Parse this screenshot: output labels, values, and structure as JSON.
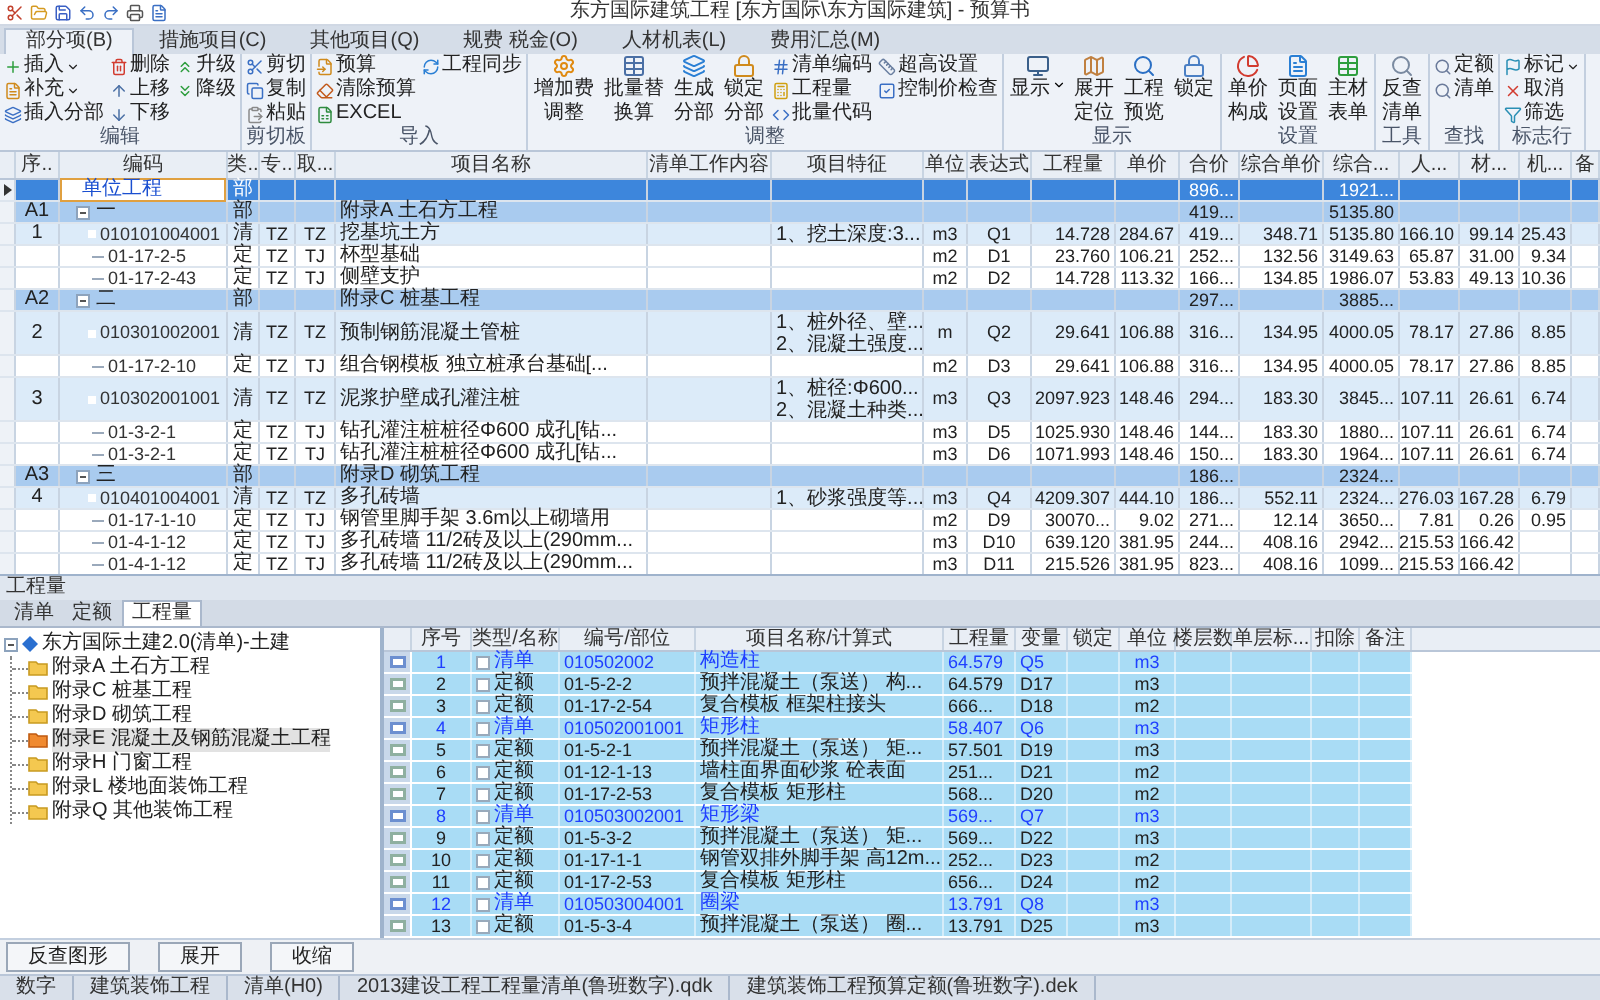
{
  "window": {
    "title": "东方国际建筑工程 [东方国际\\东方国际建筑] - 预算书"
  },
  "ribbon_tabs": [
    {
      "label": "部分项(B)",
      "selected": true
    },
    {
      "label": "措施项目(C)",
      "selected": false
    },
    {
      "label": "其他项目(Q)",
      "selected": false
    },
    {
      "label": "规费 税金(O)",
      "selected": false
    },
    {
      "label": "人材机表(L)",
      "selected": false
    },
    {
      "label": "费用汇总(M)",
      "selected": false
    }
  ],
  "ribbon_groups": [
    {
      "label": "编辑",
      "items": [
        {
          "label": "插入",
          "kind": "small",
          "dropdown": true
        },
        {
          "label": "补充",
          "kind": "small",
          "dropdown": true
        },
        {
          "label": "插入分部",
          "kind": "small"
        },
        {
          "label": "删除",
          "kind": "small"
        },
        {
          "label": "上移",
          "kind": "small"
        },
        {
          "label": "下移",
          "kind": "small"
        },
        {
          "label": "升级",
          "kind": "small"
        },
        {
          "label": "降级",
          "kind": "small"
        }
      ]
    },
    {
      "label": "剪切板",
      "items": [
        {
          "label": "剪切",
          "kind": "small"
        },
        {
          "label": "复制",
          "kind": "small"
        },
        {
          "label": "粘贴",
          "kind": "small"
        }
      ]
    },
    {
      "label": "导入",
      "items": [
        {
          "label": "预算",
          "kind": "small"
        },
        {
          "label": "清除预算",
          "kind": "small"
        },
        {
          "label": "EXCEL",
          "kind": "small"
        },
        {
          "label": "工程同步",
          "kind": "small"
        }
      ]
    },
    {
      "label": "调整",
      "items": [
        {
          "label": "增加费调整",
          "kind": "large"
        },
        {
          "label": "批量替换算",
          "kind": "large"
        },
        {
          "label": "生成分部",
          "kind": "large"
        },
        {
          "label": "锁定分部",
          "kind": "large"
        },
        {
          "label": "清单编码",
          "kind": "small"
        },
        {
          "label": "工程量",
          "kind": "small"
        },
        {
          "label": "批量代码",
          "kind": "small"
        },
        {
          "label": "超高设置",
          "kind": "small"
        },
        {
          "label": "控制价检查",
          "kind": "small"
        }
      ]
    },
    {
      "label": "显示",
      "items": [
        {
          "label": "显示",
          "kind": "large",
          "dropdown": true
        },
        {
          "label": "展开定位",
          "kind": "large"
        },
        {
          "label": "工程预览",
          "kind": "large"
        },
        {
          "label": "锁定",
          "kind": "large"
        }
      ]
    },
    {
      "label": "设置",
      "items": [
        {
          "label": "单价构成",
          "kind": "large"
        },
        {
          "label": "页面设置",
          "kind": "large"
        },
        {
          "label": "主材表单",
          "kind": "large"
        }
      ]
    },
    {
      "label": "工具",
      "items": [
        {
          "label": "反查清单",
          "kind": "large"
        }
      ]
    },
    {
      "label": "查找",
      "items": [
        {
          "label": "定额",
          "kind": "small"
        },
        {
          "label": "清单",
          "kind": "small"
        }
      ]
    },
    {
      "label": "标志行",
      "items": [
        {
          "label": "标记",
          "kind": "small",
          "dropdown": true
        },
        {
          "label": "取消",
          "kind": "small"
        },
        {
          "label": "筛选",
          "kind": "small"
        }
      ]
    }
  ],
  "estimate_table": {
    "columns": [
      "序..",
      "编码",
      "类..",
      "专..",
      "取...",
      "项目名称",
      "清单工作内容",
      "项目特征",
      "单位",
      "表达式",
      "工程量",
      "单价",
      "合价",
      "综合单价",
      "综合...",
      "人...",
      "材...",
      "机...",
      "备"
    ],
    "rows": [
      {
        "kind": "unit",
        "selected": true,
        "code": "单位工程",
        "category": "部",
        "amount": "896...",
        "comp_amount": "1921..."
      },
      {
        "kind": "section",
        "selected": false,
        "no": "A1",
        "code": "一",
        "category": "部",
        "name": "附录A 土石方工程",
        "amount": "419...",
        "comp_amount": "5135.80"
      },
      {
        "kind": "bill",
        "selected": false,
        "no": "1",
        "code": "010101004001",
        "category": "清",
        "specialty": "TZ",
        "fee": "TZ",
        "name": "挖基坑土方",
        "features": [
          "1、挖土深度:3..."
        ],
        "unit": "m3",
        "expr": "Q1",
        "qty": "14.728",
        "price": "284.67",
        "amount": "419...",
        "comp_price": "348.71",
        "comp_amount": "5135.80",
        "labor": "166.10",
        "material": "99.14",
        "machine": "25.43"
      },
      {
        "kind": "quota",
        "selected": false,
        "code": "01-17-2-5",
        "category": "定",
        "specialty": "TZ",
        "fee": "TJ",
        "name": "杯型基础",
        "unit": "m2",
        "expr": "D1",
        "qty": "23.760",
        "price": "106.21",
        "amount": "252...",
        "comp_price": "132.56",
        "comp_amount": "3149.63",
        "labor": "65.87",
        "material": "31.00",
        "machine": "9.34"
      },
      {
        "kind": "quota",
        "selected": false,
        "code": "01-17-2-43",
        "category": "定",
        "specialty": "TZ",
        "fee": "TJ",
        "name": "侧壁支护",
        "unit": "m2",
        "expr": "D2",
        "qty": "14.728",
        "price": "113.32",
        "amount": "166...",
        "comp_price": "134.85",
        "comp_amount": "1986.07",
        "labor": "53.83",
        "material": "49.13",
        "machine": "10.36"
      },
      {
        "kind": "section",
        "selected": false,
        "no": "A2",
        "code": "二",
        "category": "部",
        "name": "附录C 桩基工程",
        "amount": "297...",
        "comp_amount": "3885..."
      },
      {
        "kind": "bill",
        "selected": false,
        "no": "2",
        "code": "010301002001",
        "category": "清",
        "specialty": "TZ",
        "fee": "TZ",
        "name": "预制钢筋混凝土管桩",
        "features": [
          "1、桩外径、壁...",
          "2、混凝土强度..."
        ],
        "unit": "m",
        "expr": "Q2",
        "qty": "29.641",
        "price": "106.88",
        "amount": "316...",
        "comp_price": "134.95",
        "comp_amount": "4000.05",
        "labor": "78.17",
        "material": "27.86",
        "machine": "8.85"
      },
      {
        "kind": "quota",
        "selected": false,
        "code": "01-17-2-10",
        "category": "定",
        "specialty": "TZ",
        "fee": "TJ",
        "name": "组合钢模板 独立桩承台基础[...",
        "unit": "m2",
        "expr": "D3",
        "qty": "29.641",
        "price": "106.88",
        "amount": "316...",
        "comp_price": "134.95",
        "comp_amount": "4000.05",
        "labor": "78.17",
        "material": "27.86",
        "machine": "8.85"
      },
      {
        "kind": "bill",
        "selected": false,
        "no": "3",
        "code": "010302001001",
        "category": "清",
        "specialty": "TZ",
        "fee": "TZ",
        "name": "泥浆护壁成孔灌注桩",
        "features": [
          "1、桩径:Φ600...",
          "2、混凝土种类..."
        ],
        "unit": "m3",
        "expr": "Q3",
        "qty": "2097.923",
        "price": "148.46",
        "amount": "294...",
        "comp_price": "183.30",
        "comp_amount": "3845...",
        "labor": "107.11",
        "material": "26.61",
        "machine": "6.74"
      },
      {
        "kind": "quota",
        "selected": false,
        "code": "01-3-2-1",
        "category": "定",
        "specialty": "TZ",
        "fee": "TJ",
        "name": "钻孔灌注桩桩径Φ600 成孔[钻...",
        "unit": "m3",
        "expr": "D5",
        "qty": "1025.930",
        "price": "148.46",
        "amount": "144...",
        "comp_price": "183.30",
        "comp_amount": "1880...",
        "labor": "107.11",
        "material": "26.61",
        "machine": "6.74"
      },
      {
        "kind": "quota",
        "selected": false,
        "code": "01-3-2-1",
        "category": "定",
        "specialty": "TZ",
        "fee": "TJ",
        "name": "钻孔灌注桩桩径Φ600 成孔[钻...",
        "unit": "m3",
        "expr": "D6",
        "qty": "1071.993",
        "price": "148.46",
        "amount": "150...",
        "comp_price": "183.30",
        "comp_amount": "1964...",
        "labor": "107.11",
        "material": "26.61",
        "machine": "6.74"
      },
      {
        "kind": "section",
        "selected": false,
        "no": "A3",
        "code": "三",
        "category": "部",
        "name": "附录D 砌筑工程",
        "amount": "186...",
        "comp_amount": "2324..."
      },
      {
        "kind": "bill",
        "selected": false,
        "no": "4",
        "code": "010401004001",
        "category": "清",
        "specialty": "TZ",
        "fee": "TZ",
        "name": "多孔砖墙",
        "features": [
          "1、砂浆强度等..."
        ],
        "unit": "m3",
        "expr": "Q4",
        "qty": "4209.307",
        "price": "444.10",
        "amount": "186...",
        "comp_price": "552.11",
        "comp_amount": "2324...",
        "labor": "276.03",
        "material": "167.28",
        "machine": "6.79"
      },
      {
        "kind": "quota",
        "selected": false,
        "code": "01-17-1-10",
        "category": "定",
        "specialty": "TZ",
        "fee": "TJ",
        "name": "钢管里脚手架 3.6m以上砌墙用",
        "unit": "m2",
        "expr": "D9",
        "qty": "30070...",
        "price": "9.02",
        "amount": "271...",
        "comp_price": "12.14",
        "comp_amount": "3650...",
        "labor": "7.81",
        "material": "0.26",
        "machine": "0.95"
      },
      {
        "kind": "quota",
        "selected": false,
        "code": "01-4-1-12",
        "category": "定",
        "specialty": "TZ",
        "fee": "TJ",
        "name": "多孔砖墙 11/2砖及以上(290mm...",
        "unit": "m3",
        "expr": "D10",
        "qty": "639.120",
        "price": "381.95",
        "amount": "244...",
        "comp_price": "408.16",
        "comp_amount": "2942...",
        "labor": "215.53",
        "material": "166.42"
      },
      {
        "kind": "quota",
        "selected": false,
        "code": "01-4-1-12",
        "category": "定",
        "specialty": "TZ",
        "fee": "TJ",
        "name": "多孔砖墙 11/2砖及以上(290mm...",
        "unit": "m3",
        "expr": "D11",
        "qty": "215.526",
        "price": "381.95",
        "amount": "823...",
        "comp_price": "408.16",
        "comp_amount": "1099...",
        "labor": "215.53",
        "material": "166.42"
      }
    ]
  },
  "quantity_panel": {
    "title": "工程量",
    "tabs": [
      {
        "label": "清单",
        "selected": false
      },
      {
        "label": "定额",
        "selected": false
      },
      {
        "label": "工程量",
        "selected": true
      }
    ],
    "tree": {
      "label": "东方国际土建2.0(清单)-土建",
      "children": [
        {
          "label": "附录A 土石方工程",
          "selected": false
        },
        {
          "label": "附录C 桩基工程",
          "selected": false
        },
        {
          "label": "附录D 砌筑工程",
          "selected": false
        },
        {
          "label": "附录E 混凝土及钢筋混凝土工程",
          "selected": true
        },
        {
          "label": "附录H 门窗工程",
          "selected": false
        },
        {
          "label": "附录L 楼地面装饰工程",
          "selected": false
        },
        {
          "label": "附录Q 其他装饰工程",
          "selected": false
        }
      ]
    },
    "grid": {
      "columns": [
        "序号",
        "类型/名称",
        "编号/部位",
        "项目名称/计算式",
        "工程量",
        "变量",
        "锁定",
        "单位",
        "楼层数",
        "单层标...",
        "扣除",
        "备注"
      ],
      "rows": [
        {
          "kind": "bill",
          "checked": false,
          "no": "1",
          "type": "清单",
          "code": "010502002",
          "name": "构造柱",
          "qty": "64.579",
          "var": "Q5",
          "unit": "m3"
        },
        {
          "kind": "quota",
          "checked": false,
          "no": "2",
          "type": "定额",
          "code": "01-5-2-2",
          "name": "预拌混凝土（泵送） 构...",
          "qty": "64.579",
          "var": "D17",
          "unit": "m3"
        },
        {
          "kind": "quota",
          "checked": false,
          "no": "3",
          "type": "定额",
          "code": "01-17-2-54",
          "name": "复合模板 框架柱接头",
          "qty": "666...",
          "var": "D18",
          "unit": "m2"
        },
        {
          "kind": "bill",
          "checked": false,
          "no": "4",
          "type": "清单",
          "code": "010502001001",
          "name": "矩形柱",
          "qty": "58.407",
          "var": "Q6",
          "unit": "m3"
        },
        {
          "kind": "quota",
          "checked": false,
          "no": "5",
          "type": "定额",
          "code": "01-5-2-1",
          "name": "预拌混凝土（泵送） 矩...",
          "qty": "57.501",
          "var": "D19",
          "unit": "m3"
        },
        {
          "kind": "quota",
          "checked": false,
          "no": "6",
          "type": "定额",
          "code": "01-12-1-13",
          "name": "墙柱面界面砂浆 砼表面",
          "qty": "251...",
          "var": "D21",
          "unit": "m2"
        },
        {
          "kind": "quota",
          "checked": false,
          "no": "7",
          "type": "定额",
          "code": "01-17-2-53",
          "name": "复合模板 矩形柱",
          "qty": "568...",
          "var": "D20",
          "unit": "m2"
        },
        {
          "kind": "bill",
          "checked": false,
          "no": "8",
          "type": "清单",
          "code": "010503002001",
          "name": "矩形梁",
          "qty": "569...",
          "var": "Q7",
          "unit": "m3"
        },
        {
          "kind": "quota",
          "checked": false,
          "no": "9",
          "type": "定额",
          "code": "01-5-3-2",
          "name": "预拌混凝土（泵送） 矩...",
          "qty": "569...",
          "var": "D22",
          "unit": "m3"
        },
        {
          "kind": "quota",
          "checked": false,
          "no": "10",
          "type": "定额",
          "code": "01-17-1-1",
          "name": "钢管双排外脚手架 高12m...",
          "qty": "252...",
          "var": "D23",
          "unit": "m2"
        },
        {
          "kind": "quota",
          "checked": false,
          "no": "11",
          "type": "定额",
          "code": "01-17-2-53",
          "name": "复合模板 矩形柱",
          "qty": "656...",
          "var": "D24",
          "unit": "m2"
        },
        {
          "kind": "bill",
          "checked": false,
          "no": "12",
          "type": "清单",
          "code": "010503004001",
          "name": "圈梁",
          "qty": "13.791",
          "var": "Q8",
          "unit": "m3"
        },
        {
          "kind": "quota",
          "checked": false,
          "no": "13",
          "type": "定额",
          "code": "01-5-3-4",
          "name": "预拌混凝土（泵送） 圈...",
          "qty": "13.791",
          "var": "D25",
          "unit": "m3"
        }
      ]
    },
    "buttons": [
      "反查图形",
      "展开",
      "收缩"
    ]
  },
  "status_bar": [
    "数字",
    "建筑装饰工程",
    "清单(H0)",
    "2013建设工程工程量清单(鲁班数字).qdk",
    "建筑装饰工程预算定额(鲁班数字).dek"
  ]
}
